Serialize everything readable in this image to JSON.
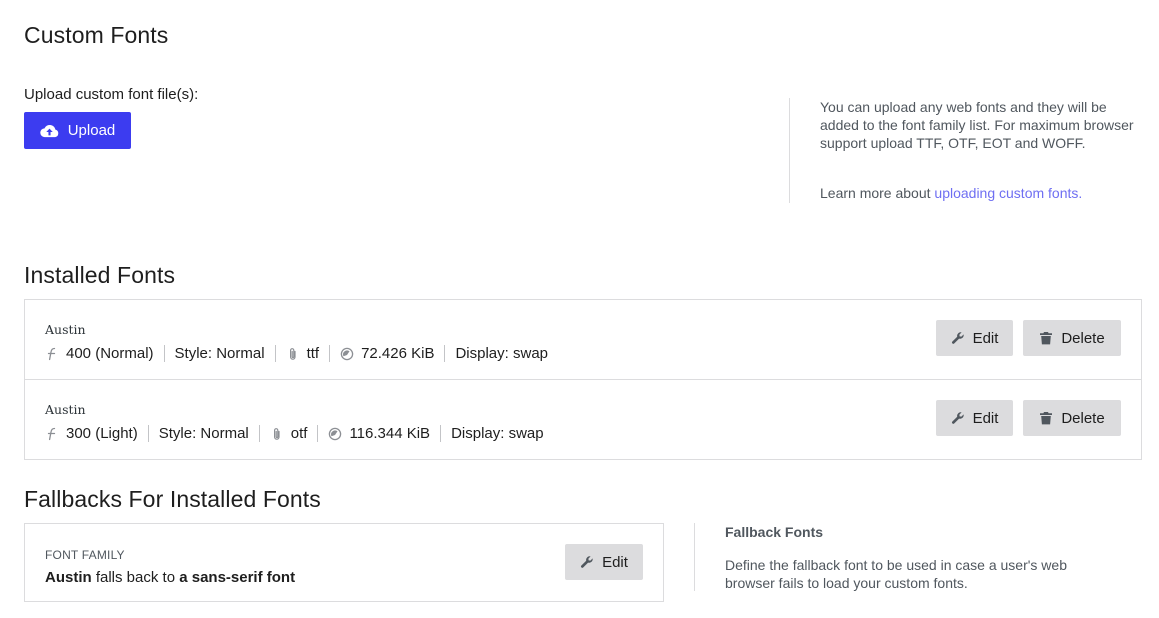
{
  "custom_fonts": {
    "title": "Custom Fonts",
    "upload_label": "Upload custom font file(s):",
    "upload_button": "Upload",
    "help_text": "You can upload any web fonts and they will be added to the font family list. For maximum browser support upload TTF, OTF, EOT and WOFF.",
    "learn_prefix": "Learn more about ",
    "learn_link": "uploading custom fonts."
  },
  "installed_fonts": {
    "title": "Installed Fonts",
    "rows": [
      {
        "name": "Austin",
        "weight": "400 (Normal)",
        "style": "Style: Normal",
        "format": "ttf",
        "size": "72.426 KiB",
        "display": "Display: swap",
        "edit": "Edit",
        "delete": "Delete"
      },
      {
        "name": "Austin",
        "weight": "300 (Light)",
        "style": "Style: Normal",
        "format": "otf",
        "size": "116.344 KiB",
        "display": "Display: swap",
        "edit": "Edit",
        "delete": "Delete"
      }
    ]
  },
  "fallbacks": {
    "title": "Fallbacks For Installed Fonts",
    "label": "FONT FAMILY",
    "family": "Austin",
    "middle": " falls back to ",
    "fallback": "a sans-serif font",
    "edit": "Edit",
    "help_title": "Fallback Fonts",
    "help_text": "Define the fallback font to be used in case a user's web browser fails to load your custom fonts."
  },
  "colors": {
    "accent": "#3c3cf0",
    "link": "#6f6ff2",
    "button_gray": "#dcdcde"
  },
  "icons": {
    "upload": "cloud-upload-icon",
    "weight": "font-weight-icon",
    "format": "paperclip-icon",
    "size": "gauge-icon",
    "edit": "wrench-icon",
    "delete": "trash-icon"
  }
}
